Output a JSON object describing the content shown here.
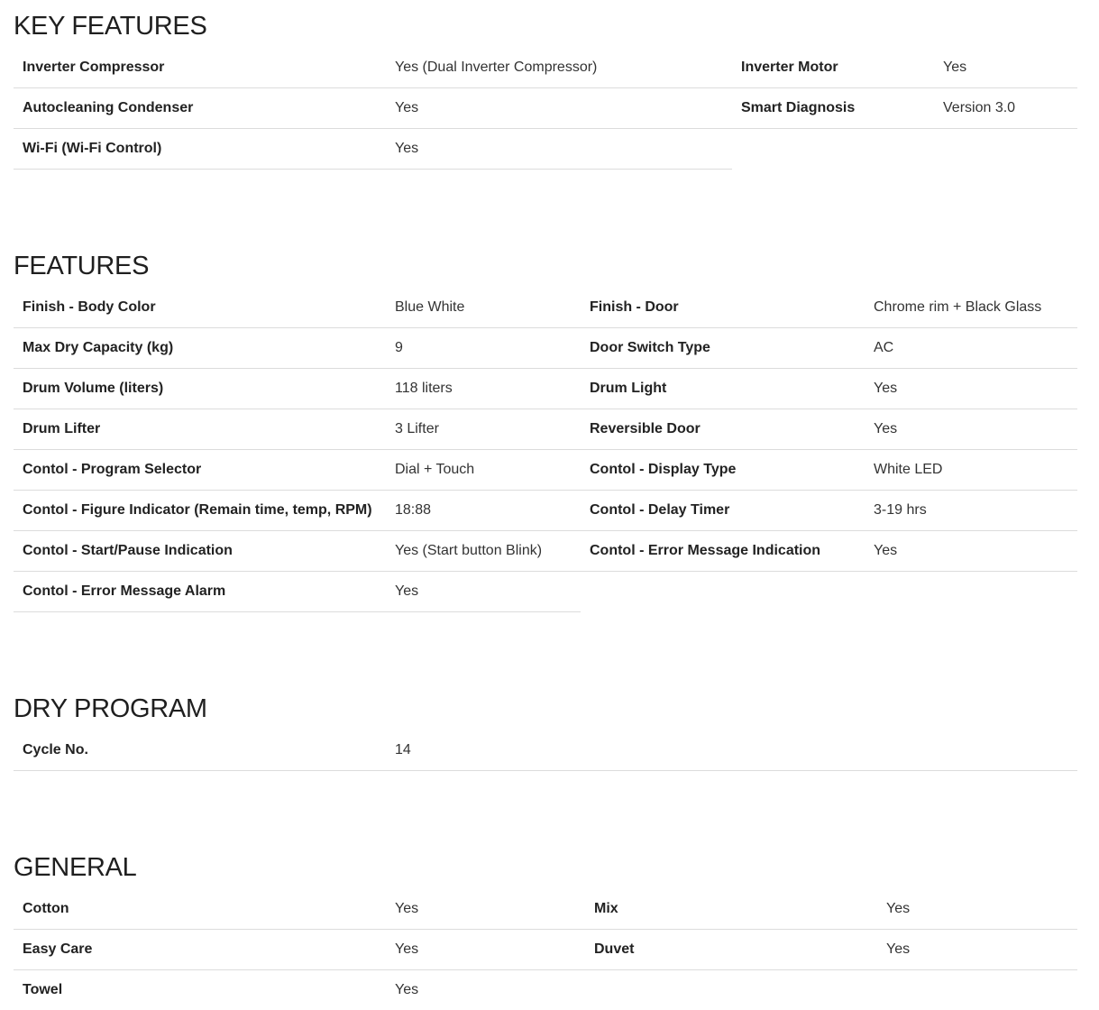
{
  "key_features": {
    "title": "KEY FEATURES",
    "left": [
      {
        "label": "Inverter Compressor",
        "value": "Yes (Dual Inverter Compressor)"
      },
      {
        "label": "Autocleaning Condenser",
        "value": "Yes"
      },
      {
        "label": "Wi-Fi (Wi-Fi Control)",
        "value": "Yes"
      }
    ],
    "right": [
      {
        "label": "Inverter Motor",
        "value": "Yes"
      },
      {
        "label": "Smart Diagnosis",
        "value": "Version 3.0"
      }
    ]
  },
  "features": {
    "title": "FEATURES",
    "left": [
      {
        "label": "Finish - Body Color",
        "value": "Blue White"
      },
      {
        "label": "Max Dry Capacity (kg)",
        "value": "9"
      },
      {
        "label": "Drum Volume (liters)",
        "value": "118 liters"
      },
      {
        "label": "Drum Lifter",
        "value": "3 Lifter"
      },
      {
        "label": "Contol - Program Selector",
        "value": "Dial + Touch"
      },
      {
        "label": "Contol - Figure Indicator (Remain time, temp, RPM)",
        "value": "18:88"
      },
      {
        "label": "Contol - Start/Pause Indication",
        "value": "Yes (Start button Blink)"
      },
      {
        "label": "Contol - Error Message Alarm",
        "value": "Yes"
      }
    ],
    "right": [
      {
        "label": "Finish - Door",
        "value": "Chrome rim + Black Glass"
      },
      {
        "label": "Door Switch Type",
        "value": "AC"
      },
      {
        "label": "Drum Light",
        "value": "Yes"
      },
      {
        "label": "Reversible Door",
        "value": "Yes"
      },
      {
        "label": "Contol - Display Type",
        "value": "White LED"
      },
      {
        "label": "Contol - Delay Timer",
        "value": "3-19 hrs"
      },
      {
        "label": "Contol - Error Message Indication",
        "value": "Yes"
      }
    ]
  },
  "dry_program": {
    "title": "DRY PROGRAM",
    "rows": [
      {
        "label": "Cycle No.",
        "value": "14"
      }
    ]
  },
  "general": {
    "title": "GENERAL",
    "left": [
      {
        "label": "Cotton",
        "value": "Yes"
      },
      {
        "label": "Easy Care",
        "value": "Yes"
      },
      {
        "label": "Towel",
        "value": "Yes"
      }
    ],
    "right": [
      {
        "label": "Mix",
        "value": "Yes"
      },
      {
        "label": "Duvet",
        "value": "Yes"
      }
    ]
  }
}
